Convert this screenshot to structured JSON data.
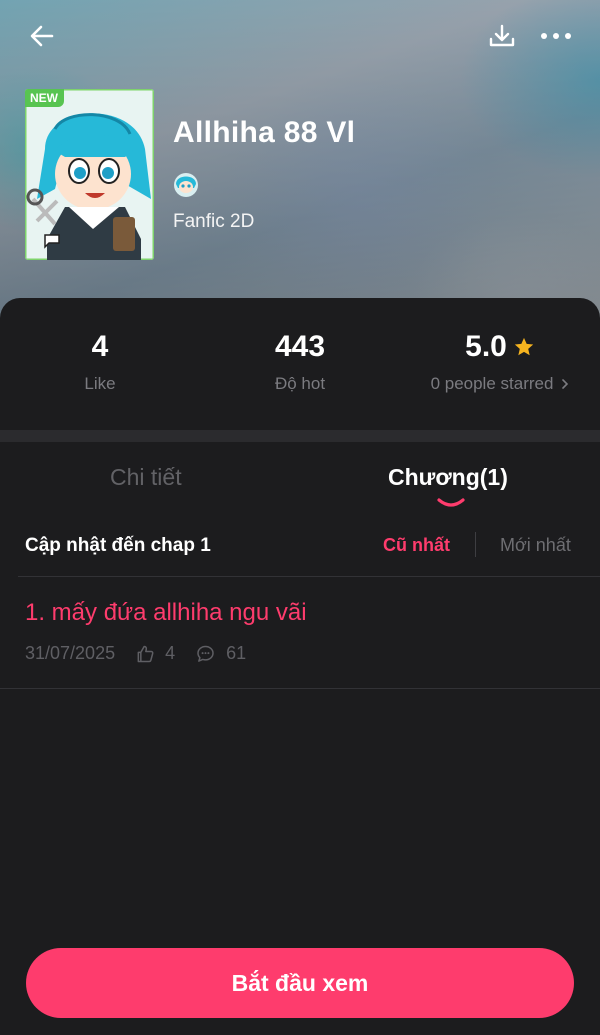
{
  "header": {
    "back_icon": "arrow-left-icon",
    "download_icon": "download-icon",
    "more_icon": "more-horizontal-icon"
  },
  "comic": {
    "badge": "NEW",
    "title": "Allhiha 88 Vl",
    "genre": "Fanfic 2D"
  },
  "stats": {
    "likes_value": "4",
    "likes_label": "Like",
    "hot_value": "443",
    "hot_label": "Độ hot",
    "rating_value": "5.0",
    "rating_label": "0 people starred"
  },
  "tabs": {
    "details": "Chi tiết",
    "chapters": "Chương(1)"
  },
  "chapters_section": {
    "update_text": "Cập nhật đến chap 1",
    "sort_oldest": "Cũ nhất",
    "sort_newest": "Mới nhất",
    "items": [
      {
        "title": "1. mấy đứa allhiha ngu vãi",
        "date": "31/07/2025",
        "likes": "4",
        "comments": "61"
      }
    ]
  },
  "cta": {
    "label": "Bắt đầu xem"
  },
  "colors": {
    "accent": "#fe3c6d",
    "star": "#f5b31f",
    "badge": "#58c451"
  }
}
